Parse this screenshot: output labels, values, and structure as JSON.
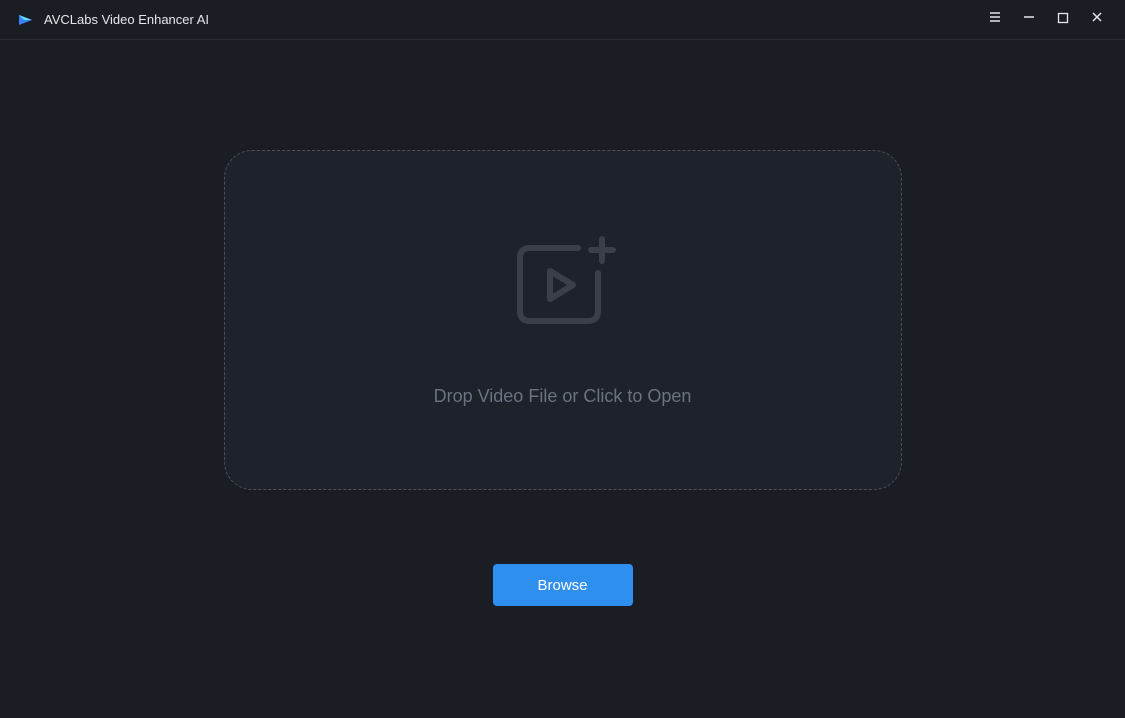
{
  "titlebar": {
    "app_title": "AVCLabs Video Enhancer AI"
  },
  "main": {
    "drop_text": "Drop Video File or Click to Open",
    "browse_label": "Browse"
  }
}
